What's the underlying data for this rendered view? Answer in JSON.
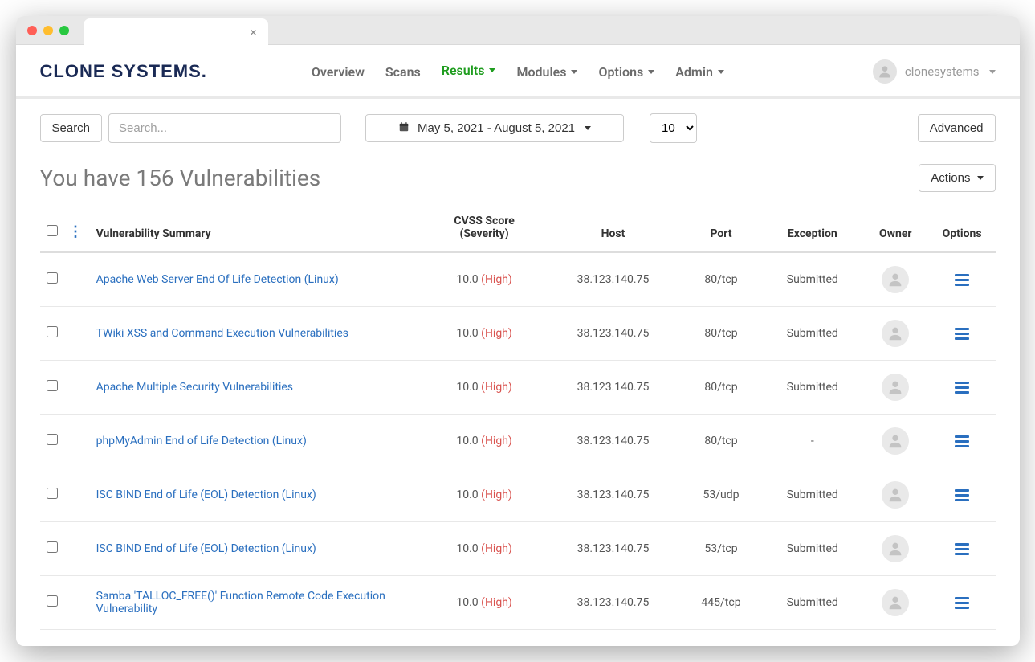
{
  "titlebar": {
    "close_glyph": "×"
  },
  "logo": "CLONE SYSTEMS.",
  "nav": {
    "items": [
      {
        "label": "Overview",
        "caret": false,
        "active": false
      },
      {
        "label": "Scans",
        "caret": false,
        "active": false
      },
      {
        "label": "Results",
        "caret": true,
        "active": true
      },
      {
        "label": "Modules",
        "caret": true,
        "active": false
      },
      {
        "label": "Options",
        "caret": true,
        "active": false
      },
      {
        "label": "Admin",
        "caret": true,
        "active": false
      }
    ],
    "username": "clonesystems"
  },
  "toolbar": {
    "search_button": "Search",
    "search_placeholder": "Search...",
    "date_range": "May 5, 2021 - August 5, 2021",
    "page_size": "10",
    "advanced_button": "Advanced"
  },
  "heading": "You have 156 Vulnerabilities",
  "actions_button": "Actions",
  "columns": {
    "summary": "Vulnerability Summary",
    "cvss_line1": "CVSS Score",
    "cvss_line2": "(Severity)",
    "host": "Host",
    "port": "Port",
    "exception": "Exception",
    "owner": "Owner",
    "options": "Options"
  },
  "rows": [
    {
      "summary": "Apache Web Server End Of Life Detection (Linux)",
      "score": "10.0",
      "severity": "High",
      "host": "38.123.140.75",
      "port": "80/tcp",
      "exception": "Submitted"
    },
    {
      "summary": "TWiki XSS and Command Execution Vulnerabilities",
      "score": "10.0",
      "severity": "High",
      "host": "38.123.140.75",
      "port": "80/tcp",
      "exception": "Submitted"
    },
    {
      "summary": "Apache Multiple Security Vulnerabilities",
      "score": "10.0",
      "severity": "High",
      "host": "38.123.140.75",
      "port": "80/tcp",
      "exception": "Submitted"
    },
    {
      "summary": "phpMyAdmin End of Life Detection (Linux)",
      "score": "10.0",
      "severity": "High",
      "host": "38.123.140.75",
      "port": "80/tcp",
      "exception": "-"
    },
    {
      "summary": "ISC BIND End of Life (EOL) Detection (Linux)",
      "score": "10.0",
      "severity": "High",
      "host": "38.123.140.75",
      "port": "53/udp",
      "exception": "Submitted"
    },
    {
      "summary": "ISC BIND End of Life (EOL) Detection (Linux)",
      "score": "10.0",
      "severity": "High",
      "host": "38.123.140.75",
      "port": "53/tcp",
      "exception": "Submitted"
    },
    {
      "summary": "Samba 'TALLOC_FREE()' Function Remote Code Execution Vulnerability",
      "score": "10.0",
      "severity": "High",
      "host": "38.123.140.75",
      "port": "445/tcp",
      "exception": "Submitted"
    }
  ]
}
